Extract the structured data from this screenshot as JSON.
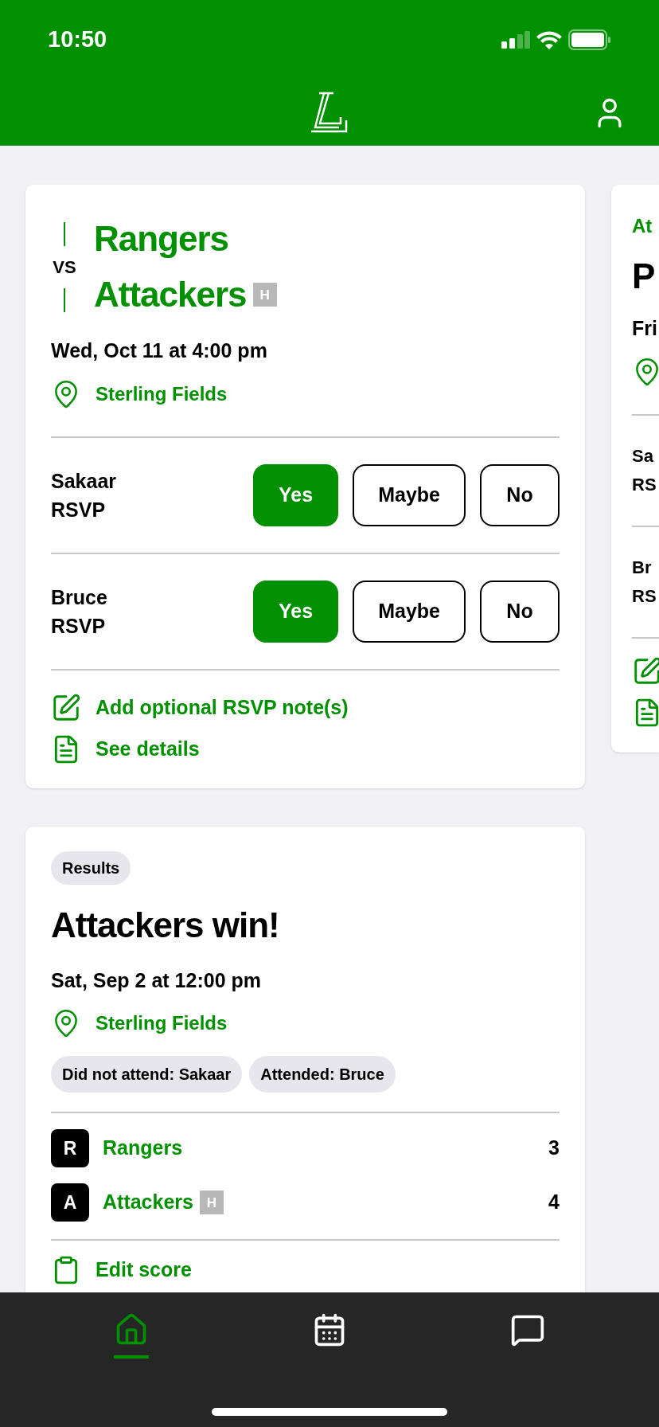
{
  "status_bar": {
    "time": "10:50"
  },
  "upcoming_game": {
    "vs_label": "VS",
    "teams": [
      {
        "name": "Rangers",
        "home": false
      },
      {
        "name": "Attackers",
        "home": true,
        "home_label": "H"
      }
    ],
    "datetime": "Wed, Oct 11 at 4:00 pm",
    "location": "Sterling Fields",
    "rsvps": [
      {
        "name": "Sakaar",
        "label": "RSVP",
        "options": [
          {
            "label": "Yes",
            "selected": true
          },
          {
            "label": "Maybe",
            "selected": false
          },
          {
            "label": "No",
            "selected": false
          }
        ]
      },
      {
        "name": "Bruce",
        "label": "RSVP",
        "options": [
          {
            "label": "Yes",
            "selected": true
          },
          {
            "label": "Maybe",
            "selected": false
          },
          {
            "label": "No",
            "selected": false
          }
        ]
      }
    ],
    "links": [
      {
        "kind": "note",
        "label": "Add optional RSVP note(s)"
      },
      {
        "kind": "details",
        "label": "See details"
      }
    ]
  },
  "next_card": {
    "team": "At",
    "title": "P",
    "date": "Fri",
    "rsvps": [
      {
        "name": "Sa",
        "label": "RS"
      },
      {
        "name": "Br",
        "label": "RS"
      }
    ]
  },
  "result_card": {
    "badge": "Results",
    "title": "Attackers win!",
    "datetime": "Sat, Sep 2 at 12:00 pm",
    "location": "Sterling Fields",
    "attendance": [
      "Did not attend: Sakaar",
      "Attended: Bruce"
    ],
    "teams": [
      {
        "initial": "R",
        "name": "Rangers",
        "home": false,
        "score": "3"
      },
      {
        "initial": "A",
        "name": "Attackers",
        "home": true,
        "home_label": "H",
        "score": "4"
      }
    ],
    "action": "Edit score"
  },
  "tab_bar": [
    {
      "kind": "home",
      "selected": true
    },
    {
      "kind": "calendar",
      "selected": false
    },
    {
      "kind": "chat",
      "selected": false
    }
  ]
}
